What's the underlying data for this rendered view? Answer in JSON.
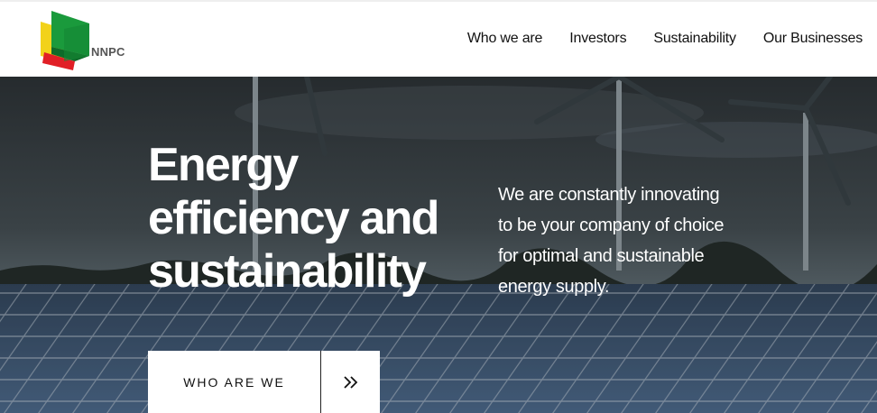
{
  "header": {
    "logo_text": "NNPC",
    "nav": [
      {
        "label": "Who we are"
      },
      {
        "label": "Investors"
      },
      {
        "label": "Sustainability"
      },
      {
        "label": "Our Businesses"
      }
    ]
  },
  "hero": {
    "headline": [
      "Energy",
      "efficiency and",
      "sustainability"
    ],
    "intro": [
      "We are constantly innovating",
      "to be your company of choice",
      "for optimal and sustainable",
      "energy supply."
    ],
    "cta_label": "WHO ARE WE",
    "cta_icon": "double-chevron-right-icon"
  },
  "colors": {
    "logo_green": "#1a9a3c",
    "logo_yellow": "#f2d21a",
    "logo_red": "#e11f26",
    "sky_dark": "#2c3236",
    "panel_blue": "#4b6686"
  }
}
